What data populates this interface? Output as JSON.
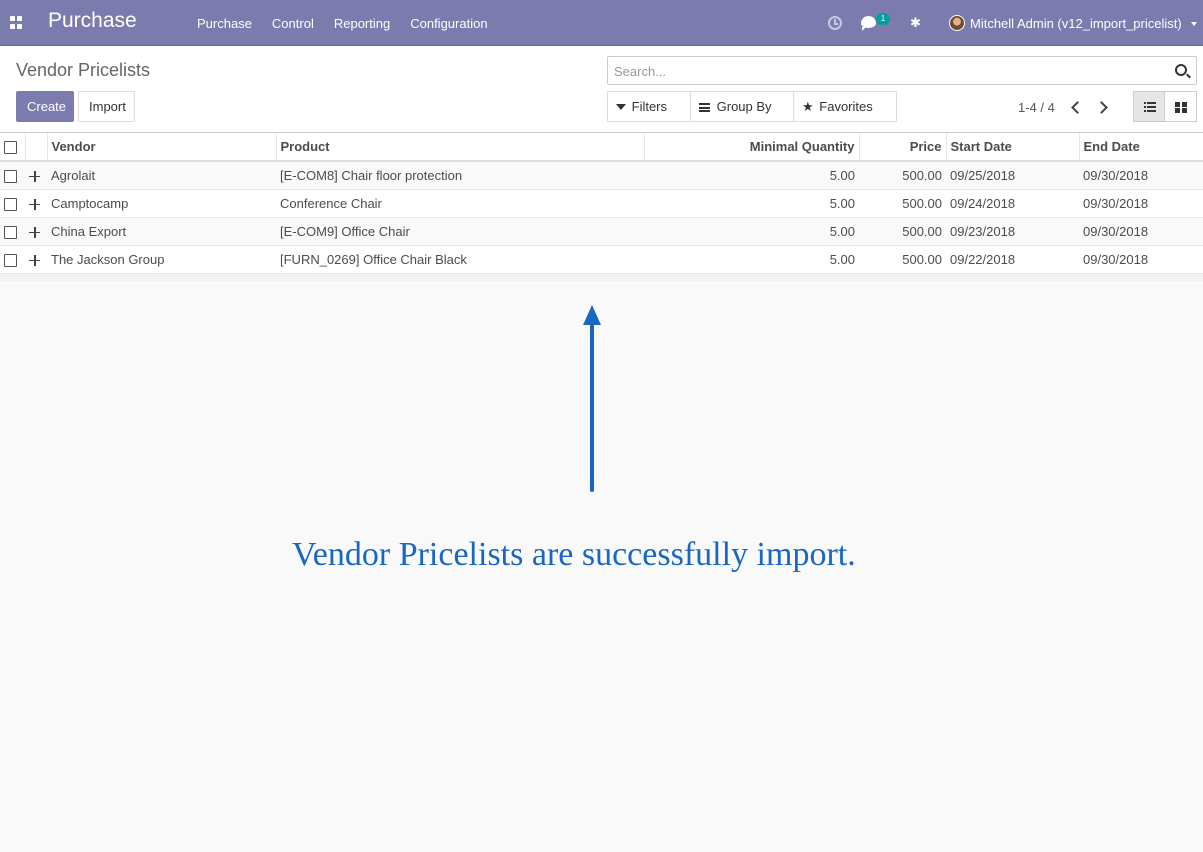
{
  "navbar": {
    "brand": "Purchase",
    "menu": [
      {
        "label": "Purchase"
      },
      {
        "label": "Control"
      },
      {
        "label": "Reporting"
      },
      {
        "label": "Configuration"
      }
    ],
    "messages_badge": "1",
    "user": "Mitchell Admin (v12_import_pricelist)",
    "icons": [
      "apps-icon",
      "clock-icon",
      "chat-icon",
      "bug-icon",
      "avatar"
    ]
  },
  "control": {
    "title": "Vendor Pricelists",
    "create_label": "Create",
    "import_label": "Import",
    "search_placeholder": "Search...",
    "filters_label": "Filters",
    "groupby_label": "Group By",
    "favorites_label": "Favorites",
    "pager": "1-4 / 4"
  },
  "table": {
    "columns": [
      "Vendor",
      "Product",
      "Minimal Quantity",
      "Price",
      "Start Date",
      "End Date"
    ],
    "rows": [
      {
        "vendor": "Agrolait",
        "product": "[E-COM8] Chair floor protection",
        "min_qty": "5.00",
        "price": "500.00",
        "start": "09/25/2018",
        "end": "09/30/2018"
      },
      {
        "vendor": "Camptocamp",
        "product": "Conference Chair",
        "min_qty": "5.00",
        "price": "500.00",
        "start": "09/24/2018",
        "end": "09/30/2018"
      },
      {
        "vendor": "China Export",
        "product": "[E-COM9] Office Chair",
        "min_qty": "5.00",
        "price": "500.00",
        "start": "09/23/2018",
        "end": "09/30/2018"
      },
      {
        "vendor": "The Jackson Group",
        "product": "[FURN_0269] Office Chair Black",
        "min_qty": "5.00",
        "price": "500.00",
        "start": "09/22/2018",
        "end": "09/30/2018"
      }
    ]
  },
  "annotation": {
    "text": "Vendor Pricelists are successfully import.",
    "color": "#1a67c1"
  },
  "colors": {
    "navbar": "#7c7bad",
    "primary_button": "#7c7bad",
    "badge": "#00a09d"
  }
}
